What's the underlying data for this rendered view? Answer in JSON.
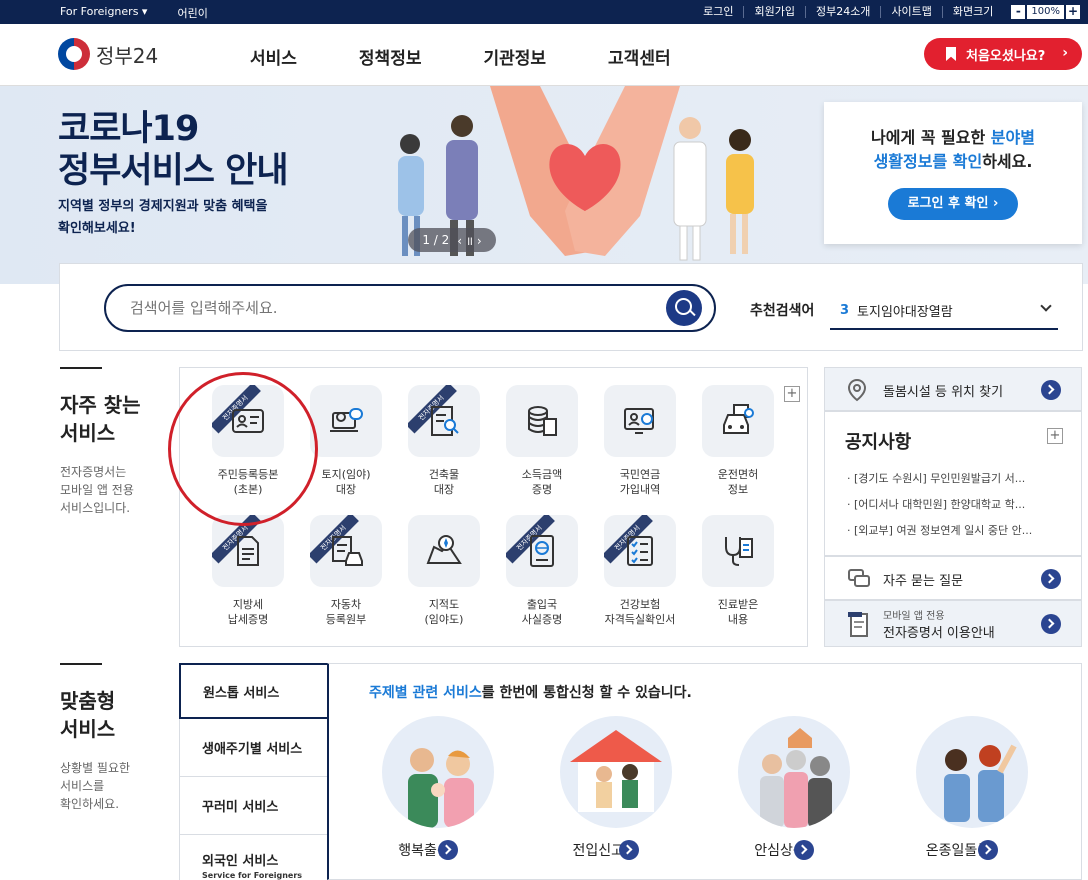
{
  "topbar": {
    "foreigners": "For Foreigners ▾",
    "kids": "어린이",
    "links": [
      "로그인",
      "회원가입",
      "정부24소개",
      "사이트맵"
    ],
    "zoom_label": "화면크기",
    "zoom_minus": "-",
    "zoom_value": "100%",
    "zoom_plus": "+"
  },
  "header": {
    "logo": "정부24",
    "nav": [
      "서비스",
      "정책정보",
      "기관정보",
      "고객센터"
    ],
    "first_visit": "처음오셨나요?",
    "arrow": "›"
  },
  "banner": {
    "title_line1": "코로나19",
    "title_line2": "정부서비스 안내",
    "sub_line1": "지역별 정부의 경제지원과 맞춤 혜택을",
    "sub_line2": "확인해보세요!",
    "pager": "1 / 2",
    "pager_controls": "‹ ॥ ›"
  },
  "side_card": {
    "line1_a": "나에게 꼭 필요한 ",
    "line1_b": "분야별",
    "line2_a": "생활정보를 확인",
    "line2_b": "하세요.",
    "button": "로그인 후 확인 ›"
  },
  "search": {
    "placeholder": "검색어를 입력해주세요.",
    "rec_label": "추천검색어",
    "rec_num": "3",
    "rec_term": "토지임야대장열람"
  },
  "freq": {
    "title_line1": "자주 찾는",
    "title_line2": "서비스",
    "desc_line1": "전자증명서는",
    "desc_line2": "모바일 앱 전용",
    "desc_line3": "서비스입니다.",
    "plus": "+",
    "ribbon": "전자증명서",
    "items": [
      {
        "l1": "주민등록등본",
        "l2": "(초본)"
      },
      {
        "l1": "토지(임야)",
        "l2": "대장"
      },
      {
        "l1": "건축물",
        "l2": "대장"
      },
      {
        "l1": "소득금액",
        "l2": "증명"
      },
      {
        "l1": "국민연금",
        "l2": "가입내역"
      },
      {
        "l1": "운전면허",
        "l2": "정보"
      },
      {
        "l1": "지방세",
        "l2": "납세증명"
      },
      {
        "l1": "자동차",
        "l2": "등록원부"
      },
      {
        "l1": "지적도",
        "l2": "(임야도)"
      },
      {
        "l1": "출입국",
        "l2": "사실증명"
      },
      {
        "l1": "건강보험",
        "l2": "자격득실확인서"
      },
      {
        "l1": "진료받은",
        "l2": "내용"
      }
    ]
  },
  "right": {
    "care": "돌봄시설 등 위치 찾기",
    "notice_title": "공지사항",
    "notice_plus": "+",
    "notices": [
      "[경기도 수원시] 무인민원발급기 서...",
      "[어디서나 대학민원] 한양대학교 학...",
      "[외교부] 여권 정보연계 일시 중단 안..."
    ],
    "faq": "자주 묻는 질문",
    "mobile_small": "모바일 앱 전용",
    "mobile_main": "전자증명서 이용안내"
  },
  "custom": {
    "title_line1": "맞춤형",
    "title_line2": "서비스",
    "desc_line1": "상황별 필요한",
    "desc_line2": "서비스를",
    "desc_line3": "확인하세요.",
    "tabs": [
      "원스톱 서비스",
      "생애주기별 서비스",
      "꾸러미 서비스",
      "외국인 서비스"
    ],
    "tab_small": "Service for Foreigners",
    "head_hl": "주제별 관련 서비스",
    "head_rest": "를 한번에 통합신청 할 수 있습니다.",
    "services": [
      "행복출산",
      "전입신고⁺",
      "안심상속",
      "온종일돌봄"
    ]
  },
  "colors": {
    "navy": "#0d2350",
    "red": "#e2202f",
    "blue": "#1a7ad6"
  }
}
